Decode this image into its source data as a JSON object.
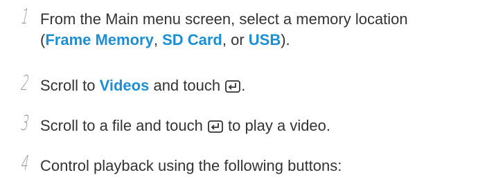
{
  "steps": [
    {
      "number": "1",
      "line1": "From the Main menu screen, select a memory location",
      "line2_open": "(",
      "kw_frame_memory": "Frame Memory",
      "sep1": ", ",
      "kw_sd_card": "SD Card",
      "sep2": ", or ",
      "kw_usb": "USB",
      "line2_close": ")."
    },
    {
      "number": "2",
      "before": "Scroll to ",
      "kw_videos": "Videos",
      "middle": " and touch ",
      "icon": "enter-icon",
      "after": "."
    },
    {
      "number": "3",
      "before": "Scroll to a file and touch ",
      "icon": "enter-icon",
      "after": " to play a video."
    },
    {
      "number": "4",
      "text": "Control playback using the following buttons:"
    }
  ],
  "colors": {
    "text": "#333333",
    "keyword": "#1b8fd6",
    "step_number": "#9a9a9a"
  }
}
